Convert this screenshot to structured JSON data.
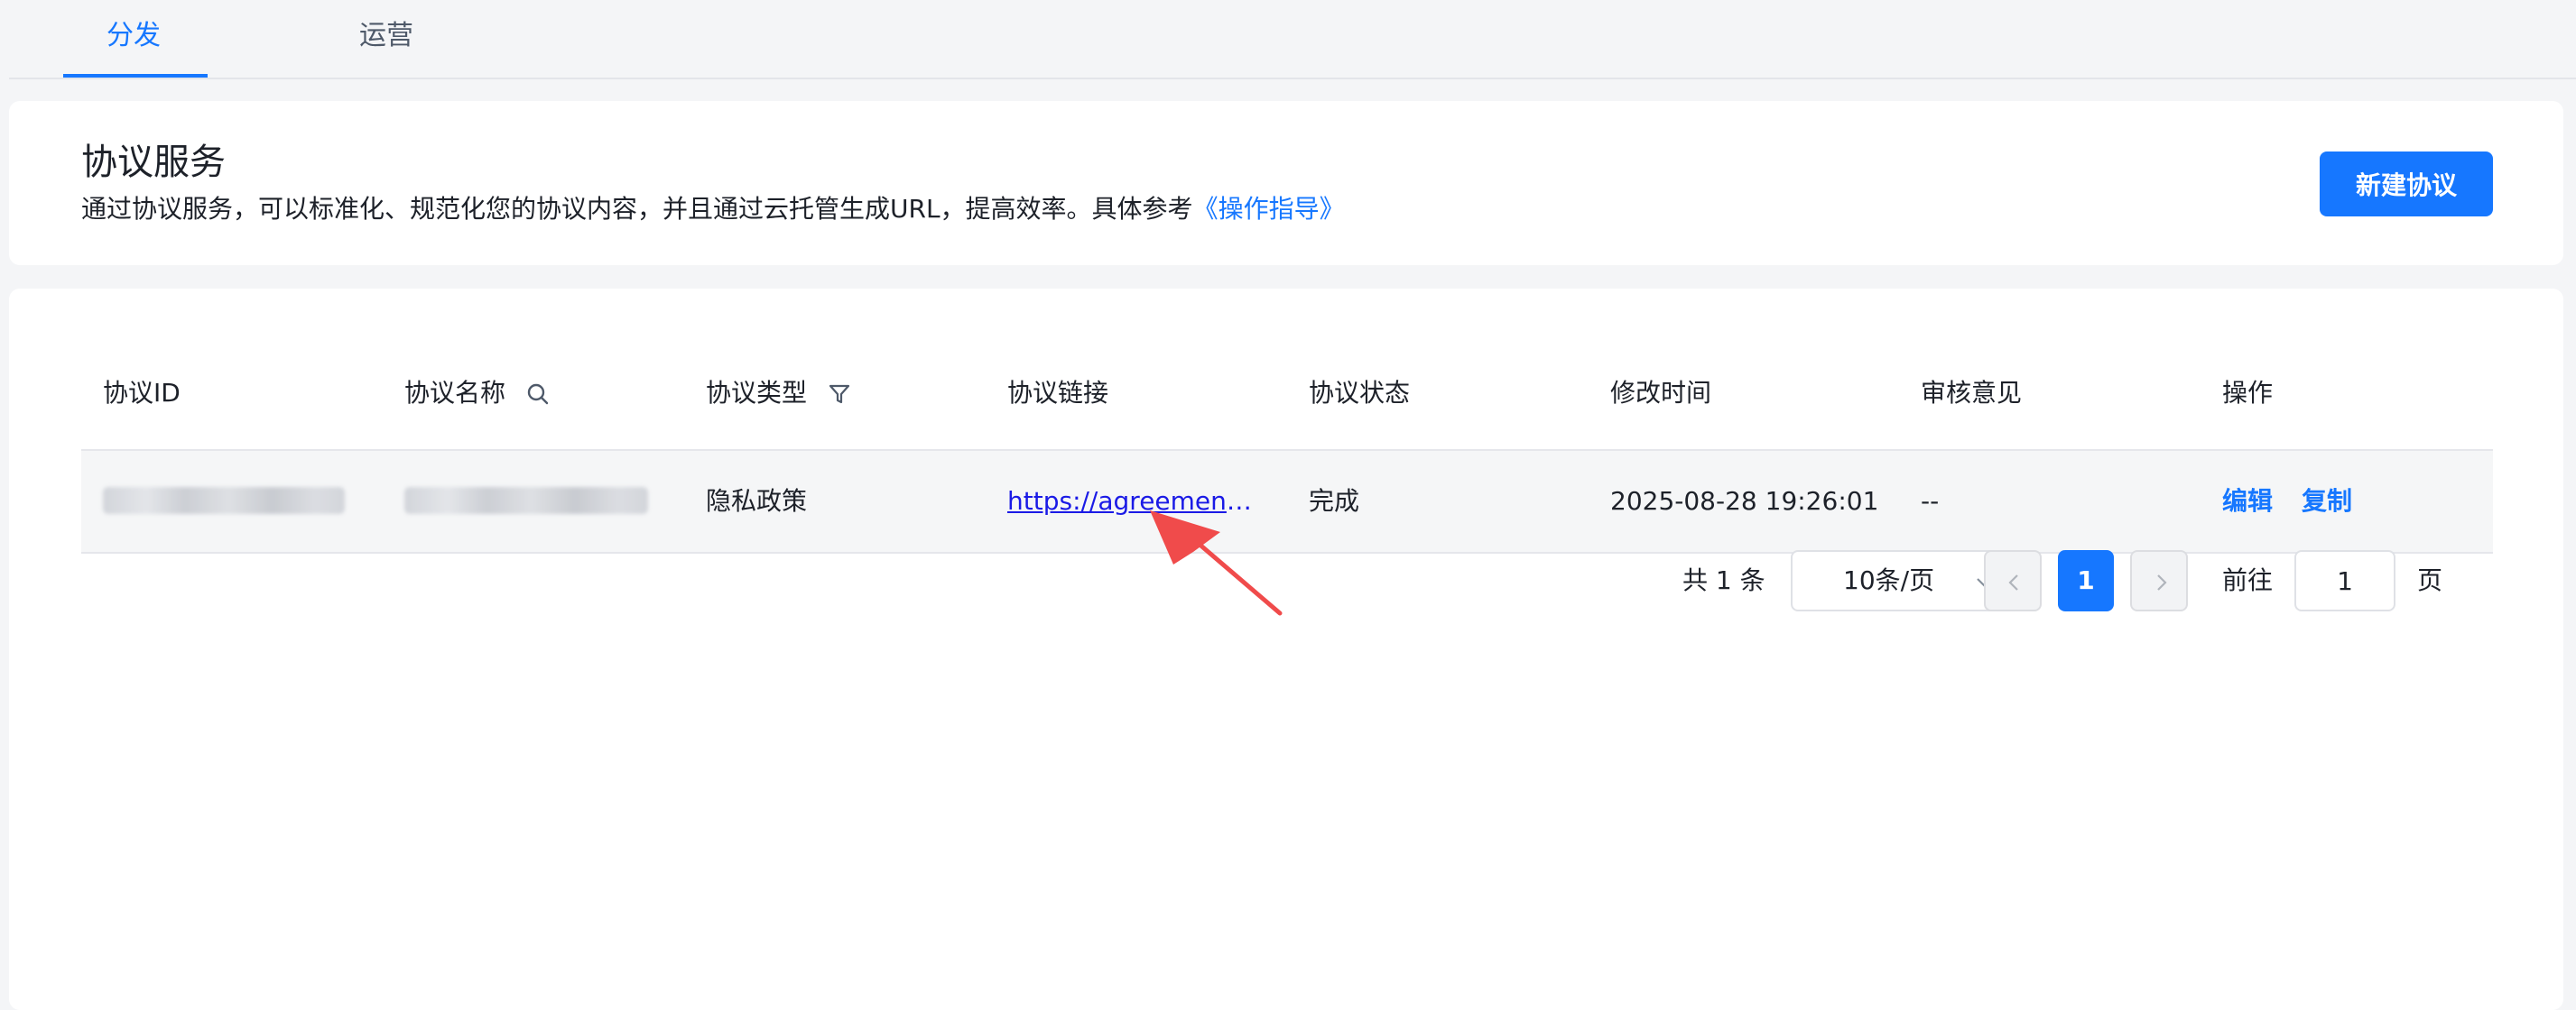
{
  "tabs": [
    {
      "label": "分发",
      "active": true
    },
    {
      "label": "运营",
      "active": false
    }
  ],
  "header": {
    "title": "协议服务",
    "description": "通过协议服务，可以标准化、规范化您的协议内容，并且通过云托管生成URL，提高效率。具体参考",
    "guide_link": "《操作指导》",
    "create_button": "新建协议"
  },
  "table": {
    "columns": [
      "协议ID",
      "协议名称",
      "协议类型",
      "协议链接",
      "协议状态",
      "修改时间",
      "审核意见",
      "操作"
    ],
    "rows": [
      {
        "type": "隐私政策",
        "link": "https://agreement…",
        "status": "完成",
        "modified": "2025-08-28 19:26:01",
        "review": "--",
        "actions": [
          "编辑",
          "复制"
        ]
      }
    ]
  },
  "pagination": {
    "total": "共 1 条",
    "page_size": "10条/页",
    "current_page": "1",
    "goto_label": "前往",
    "goto_value": "1",
    "goto_suffix": "页"
  },
  "colors": {
    "accent": "#1677ff",
    "annotation_arrow": "#f04b4b"
  },
  "icons": {
    "name_column": "search-icon",
    "type_column": "filter-icon",
    "page_size": "chevron-down-icon",
    "prev": "chevron-left-icon",
    "next": "chevron-right-icon"
  }
}
